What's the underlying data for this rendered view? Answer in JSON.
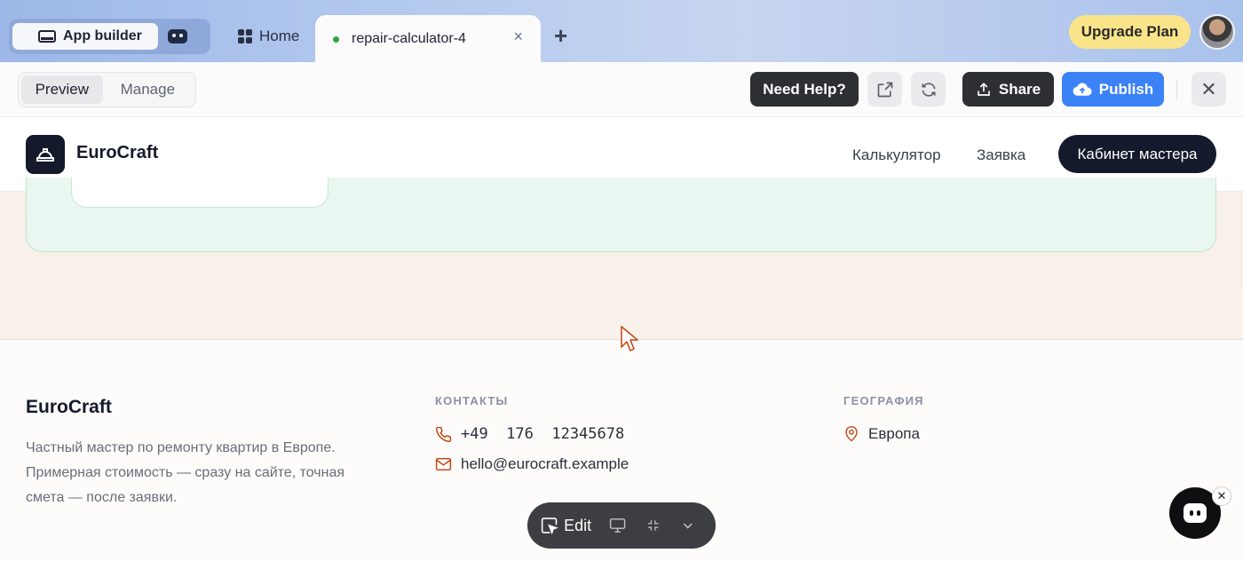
{
  "browser": {
    "mode_active_label": "App builder",
    "tabs": [
      {
        "label": "Home"
      },
      {
        "label": "repair-calculator-4"
      }
    ],
    "tab_close_glyph": "×",
    "add_tab_glyph": "+",
    "upgrade_label": "Upgrade Plan"
  },
  "toolbar": {
    "segments": [
      "Preview",
      "Manage"
    ],
    "help_label": "Need Help?",
    "share_label": "Share",
    "publish_label": "Publish",
    "close_glyph": "✕",
    "publish_color": "#3b82f6"
  },
  "site": {
    "brand": "EuroCraft",
    "nav": [
      "Калькулятор",
      "Заявка"
    ],
    "cta": "Кабинет мастера"
  },
  "footer": {
    "brand": "EuroCraft",
    "description": "Частный мастер по ремонту квартир в Европе. Примерная стоимость — сразу на сайте, точная смета — после заявки.",
    "contacts_heading": "КОНТАКТЫ",
    "phone": "+49  176  12345678",
    "email": "hello@eurocraft.example",
    "geo_heading": "ГЕОГРАФИЯ",
    "geo": "Европа",
    "accent_color": "#c2410c"
  },
  "editbar": {
    "edit_label": "Edit"
  },
  "icons": {
    "mode": "monitor-icon",
    "bot": "bot-icon",
    "home": "grid-icon",
    "external": "external-link-icon",
    "refresh": "refresh-icon",
    "share": "upload-icon",
    "publish": "cloud-upload-icon",
    "logo": "hard-hat-icon",
    "phone": "phone-icon",
    "email": "mail-icon",
    "geo": "map-pin-icon"
  }
}
